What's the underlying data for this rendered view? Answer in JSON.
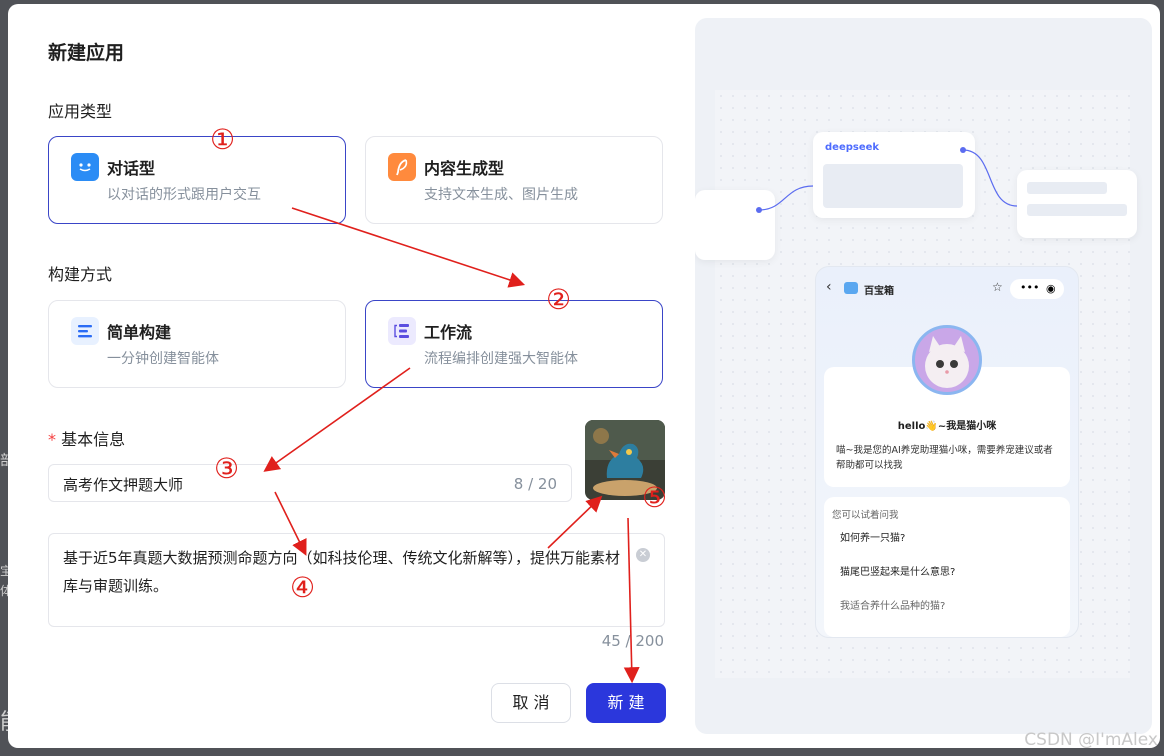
{
  "dialog": {
    "title": "新建应用",
    "app_type_label": "应用类型",
    "build_label": "构建方式",
    "basic_info_label": "基本信息",
    "required_mark": "*"
  },
  "app_types": [
    {
      "title": "对话型",
      "desc": "以对话的形式跟用户交互",
      "selected": true
    },
    {
      "title": "内容生成型",
      "desc": "支持文本生成、图片生成",
      "selected": false
    }
  ],
  "build_modes": [
    {
      "title": "简单构建",
      "desc": "一分钟创建智能体",
      "selected": false
    },
    {
      "title": "工作流",
      "desc": "流程编排创建强大智能体",
      "selected": true
    }
  ],
  "name_field": {
    "value": "高考作文押题大师",
    "count": "8 / 20"
  },
  "desc_field": {
    "value": "基于近5年真题大数据预测命题方向（如科技伦理、传统文化新解等），提供万能素材库与审题训练。",
    "count": "45 / 200"
  },
  "buttons": {
    "cancel": "取 消",
    "create": "新 建"
  },
  "preview": {
    "node_label": "deepseek",
    "phone_title": "百宝箱",
    "greeting": "hello👋~我是猫小咪",
    "intro": "喵~我是您的AI养宠助理猫小咪，需要养宠建议或者帮助都可以找我",
    "try_label": "您可以试着问我",
    "suggestions": [
      "如何养一只猫?",
      "猫尾巴竖起来是什么意思?",
      "我适合养什么品种的猫?"
    ]
  },
  "annotations": [
    "①",
    "②",
    "③",
    "④",
    "⑤"
  ],
  "background": {
    "left_text_1": "部",
    "left_text_2": "宝",
    "left_text_3": "体",
    "left_text_4": "能"
  },
  "watermark": "CSDN @I'mAlex",
  "colors": {
    "accent": "#2b37dc",
    "selected_border": "#3a45c7",
    "annotation": "#e0201c"
  }
}
